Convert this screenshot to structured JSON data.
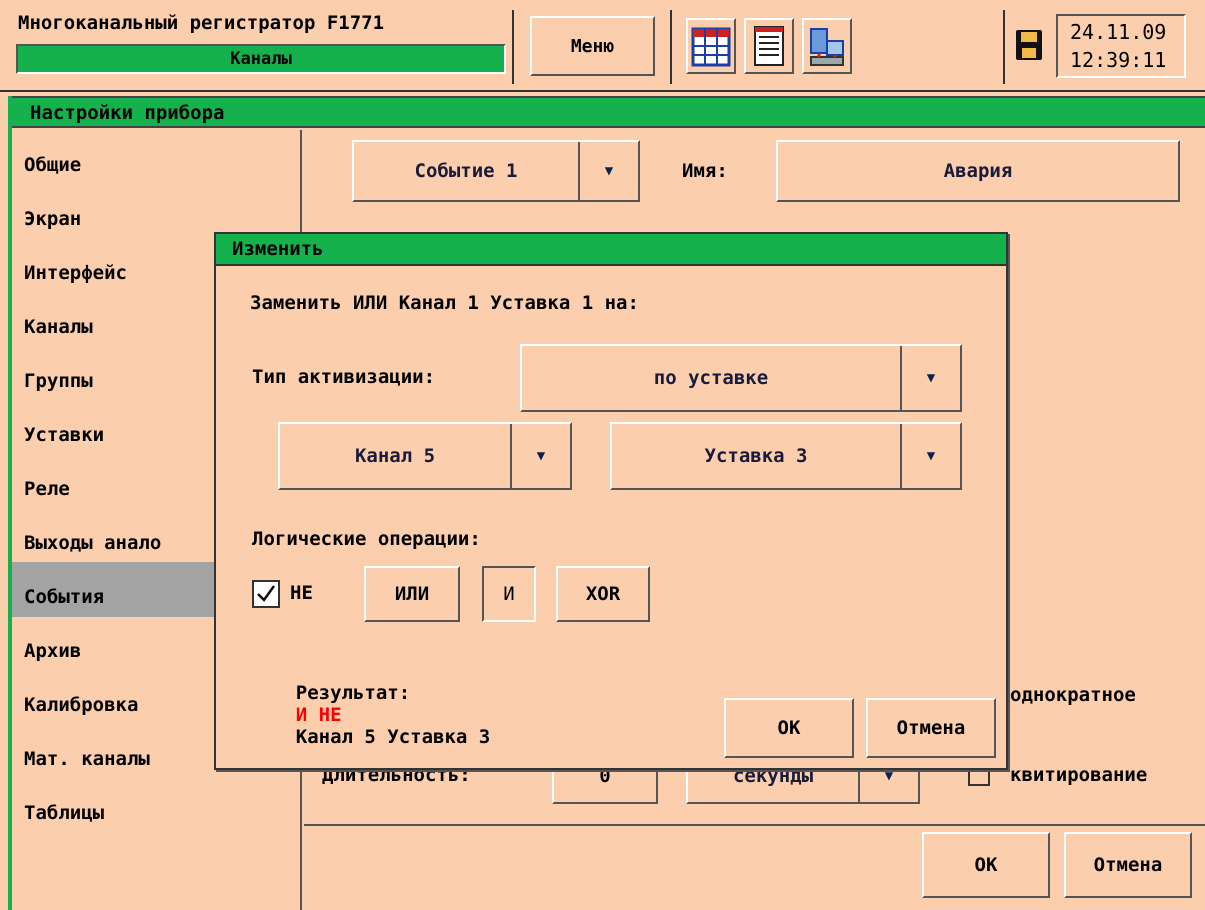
{
  "header": {
    "title": "Многоканальный регистратор F1771",
    "subtitle": "Каналы",
    "menu_label": "Меню",
    "date": "24.11.09",
    "time": "12:39:11",
    "icons": [
      "table-icon",
      "document-icon",
      "network-icon",
      "floppy-disk-icon"
    ]
  },
  "panel": {
    "title": "Настройки прибора",
    "sidebar": [
      "Общие",
      "Экран",
      "Интерфейс",
      "Каналы",
      "Группы",
      "Уставки",
      "Реле",
      "Выходы анало",
      "События",
      "Архив",
      "Калибровка",
      "Мат. каналы",
      "Таблицы"
    ],
    "selected": "События",
    "event_select": "Событие 1",
    "name_label": "Имя:",
    "name_value": "Авария",
    "duration_label": "Длительность:",
    "duration_value": "0",
    "duration_unit": "секунды",
    "single_label": "однократное",
    "ack_label": "квитирование",
    "ok": "ОК",
    "cancel": "Отмена"
  },
  "dialog": {
    "title": "Изменить",
    "replace_text": "Заменить ИЛИ Канал 1 Уставка 1 на:",
    "activation_label": "Тип активизации:",
    "activation_value": "по уставке",
    "channel_value": "Канал 5",
    "setpoint_value": "Уставка 3",
    "logic_label": "Логические операции:",
    "not_label": "НЕ",
    "not_checked": true,
    "or_label": "ИЛИ",
    "and_label": "И",
    "xor_label": "XOR",
    "result_label": "Результат:",
    "result_ops": "И НЕ",
    "result_rest": "Канал 5 Уставка 3",
    "ok": "ОК",
    "cancel": "Отмена"
  },
  "colors": {
    "background": "#fbcfae",
    "accent": "#14b14c",
    "selected": "#a3a3a3",
    "result": "#ff0000"
  }
}
